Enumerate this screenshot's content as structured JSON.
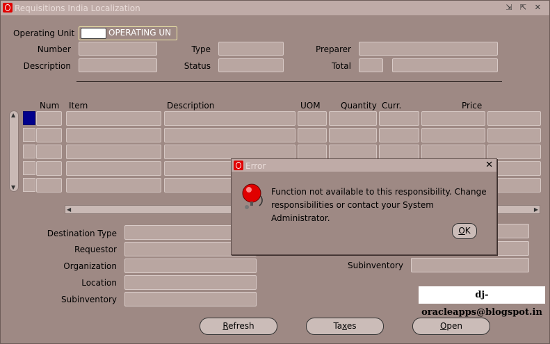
{
  "window": {
    "title": "Requisitions India Localization",
    "controls": "⇲ ⇱ ✕"
  },
  "header": {
    "operating_unit_label": "Operating Unit",
    "operating_unit_value": "OPERATING UN",
    "number_label": "Number",
    "type_label": "Type",
    "preparer_label": "Preparer",
    "description_label": "Description",
    "status_label": "Status",
    "total_label": "Total"
  },
  "lines": {
    "columns": [
      "Num",
      "Item",
      "Description",
      "UOM",
      "Quantity",
      "Curr.",
      "Price"
    ]
  },
  "details": {
    "destination_type_label": "Destination Type",
    "requestor_label": "Requestor",
    "organization_label": "Organization",
    "location_label": "Location",
    "subinventory_label": "Subinventory",
    "right_subinventory_label": "Subinventory"
  },
  "buttons": {
    "refresh": {
      "pre": "",
      "accel": "R",
      "post": "efresh"
    },
    "taxes": {
      "pre": "Ta",
      "accel": "x",
      "post": "es"
    },
    "open": {
      "pre": "",
      "accel": "O",
      "post": "pen"
    }
  },
  "dialog": {
    "title": "Error",
    "message": "Function not available to this responsibility. Change responsibilities or contact your System Administrator.",
    "ok": {
      "accel": "O",
      "post": "K"
    },
    "close": "✕"
  },
  "watermark": "dj-oracleapps@blogspot.in",
  "colors": {
    "accent_blue": "#00008c",
    "logo_red": "#e00000",
    "background": "#9e8984"
  }
}
